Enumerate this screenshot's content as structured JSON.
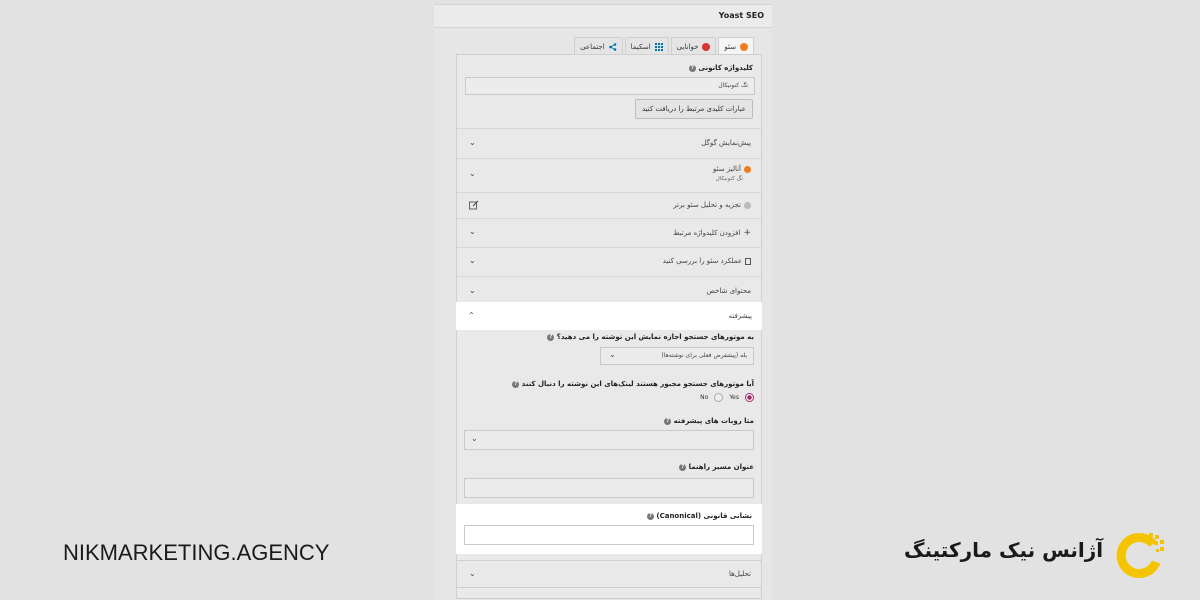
{
  "panel": {
    "title": "Yoast SEO",
    "tabs": [
      {
        "label": "سئو",
        "icon": "seo-dot-icon"
      },
      {
        "label": "خوانایی",
        "icon": "readability-dot-icon"
      },
      {
        "label": "اسکیما",
        "icon": "grid-icon"
      },
      {
        "label": "اجتماعی",
        "icon": "share-icon"
      }
    ],
    "focus_keyword": {
      "label": "کلیدواژه کانونی",
      "value": "تگ کنونیکال",
      "button": "عبارات کلیدی مرتبط را دریافت کنید"
    },
    "rows": {
      "google_preview": "پیش‌نمایش گوگل",
      "seo_analysis": "آنالیز سئو",
      "seo_analysis_sub": "تگ کنونیکال",
      "premium_analysis": "تجزیه و تحلیل سئو برتر",
      "add_keyword": "افزودن کلیدواژه مرتبط",
      "check_performance": "عملکرد سئو را بررسی کنید",
      "cornerstone": "محتوای شاخص",
      "advanced": "پیشرفته",
      "insights": "تحلیل‌ها"
    },
    "advanced": {
      "allow_search_label": "به موتورهای جستجو اجازه نمایش این نوشته را می دهید؟",
      "allow_search_value": "بله (پیشفرض فعلی برای نوشته‌ها)",
      "follow_links_label": "آیا موتورهای جستجو مجبور هستند لینک‌های این نوشته را دنبال کنند",
      "yes": "Yes",
      "no": "No",
      "meta_robots_label": "متا روبات های پیشرفته",
      "breadcrumb_label": "عنوان مسیر راهنما",
      "canonical_label": "نشانی قانونی (Canonical)"
    }
  },
  "branding": {
    "left": "NIKMARKETING.AGENCY",
    "right": "آژانس نیک مارکتینگ",
    "logo_color": "#f5c400"
  },
  "colors": {
    "accent": "#a4286a",
    "orange": "#ee7c1b",
    "red": "#dc3232",
    "link_blue": "#0073aa"
  }
}
